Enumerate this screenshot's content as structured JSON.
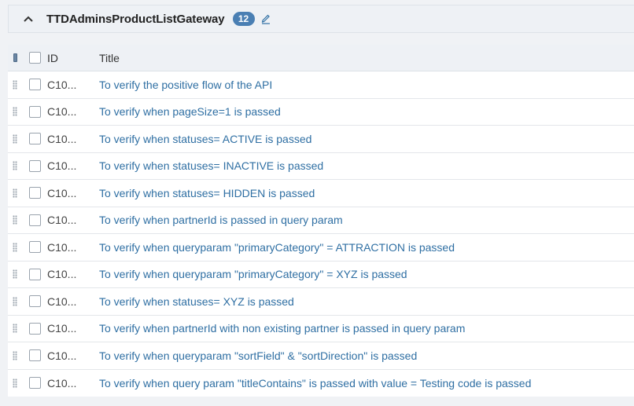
{
  "section": {
    "title": "TTDAdminsProductListGateway",
    "count": "12"
  },
  "table": {
    "columns": {
      "id": "ID",
      "title": "Title"
    },
    "rows": [
      {
        "id": "C10...",
        "title": "To verify the positive flow of the API"
      },
      {
        "id": "C10...",
        "title": "To verify when pageSize=1 is passed"
      },
      {
        "id": "C10...",
        "title": "To verify when statuses= ACTIVE is passed"
      },
      {
        "id": "C10...",
        "title": "To verify when statuses= INACTIVE is passed"
      },
      {
        "id": "C10...",
        "title": "To verify when statuses= HIDDEN is passed"
      },
      {
        "id": "C10...",
        "title": "To verify when partnerId is passed in query param"
      },
      {
        "id": "C10...",
        "title": "To verify when queryparam \"primaryCategory\" = ATTRACTION is passed"
      },
      {
        "id": "C10...",
        "title": "To verify when queryparam \"primaryCategory\" = XYZ is passed"
      },
      {
        "id": "C10...",
        "title": "To verify when statuses= XYZ is passed"
      },
      {
        "id": "C10...",
        "title": "To verify when partnerId with non existing partner is passed in query param"
      },
      {
        "id": "C10...",
        "title": "To verify when queryparam \"sortField\" & \"sortDirection\" is passed"
      },
      {
        "id": "C10...",
        "title": "To verify when query param \"titleContains\" is passed with value = Testing code is passed"
      }
    ]
  },
  "colors": {
    "link": "#2f6fa3",
    "badge": "#4a7fb3",
    "header_bg": "#eef1f5"
  },
  "icons": {
    "collapse": "chevron-up-icon",
    "edit": "pencil-icon",
    "drag": "drag-handle-icon"
  }
}
